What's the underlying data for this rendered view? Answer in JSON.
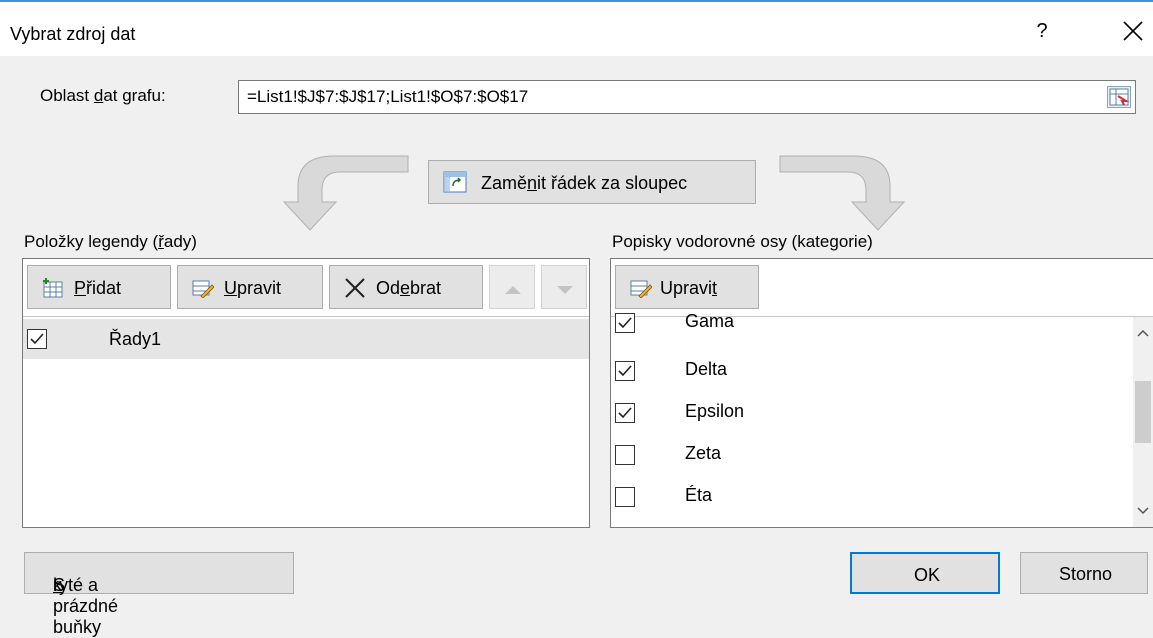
{
  "dialog": {
    "title": "Vybrat zdroj dat",
    "help": "?"
  },
  "range": {
    "label_pre": "Oblast ",
    "label_key": "d",
    "label_post": "at grafu:",
    "value": "=List1!$J$7:$J$17;List1!$O$7:$O$17"
  },
  "switch": {
    "pre": "Zamě",
    "key": "n",
    "post": "it řádek za sloupec"
  },
  "legend": {
    "header_pre": "Položky legendy (",
    "header_key": "ř",
    "header_post": "ady)",
    "add": {
      "key": "P",
      "rest": "řidat"
    },
    "edit": {
      "key": "U",
      "rest": "pravit"
    },
    "remove": {
      "pre": "Od",
      "key": "e",
      "post": "brat"
    },
    "series": [
      {
        "name": "Řady1",
        "checked": true
      }
    ]
  },
  "axis": {
    "header_pre": "Popisky vodorovné osy (kate",
    "header_key": "g",
    "header_post": "orie)",
    "edit": {
      "pre": "Upravi",
      "key": "t"
    },
    "items": [
      {
        "name": "Gama",
        "checked": true
      },
      {
        "name": "Delta",
        "checked": true
      },
      {
        "name": "Epsilon",
        "checked": true
      },
      {
        "name": "Zeta",
        "checked": false
      },
      {
        "name": "Éta",
        "checked": false
      }
    ]
  },
  "footer": {
    "hidden_pre": "S",
    "hidden_key": "k",
    "hidden_post": "ryté a prázdné buňky",
    "ok": "OK",
    "cancel": "Storno"
  },
  "colors": {
    "accent": "#0078d7",
    "title_border": "#4a90d9"
  }
}
